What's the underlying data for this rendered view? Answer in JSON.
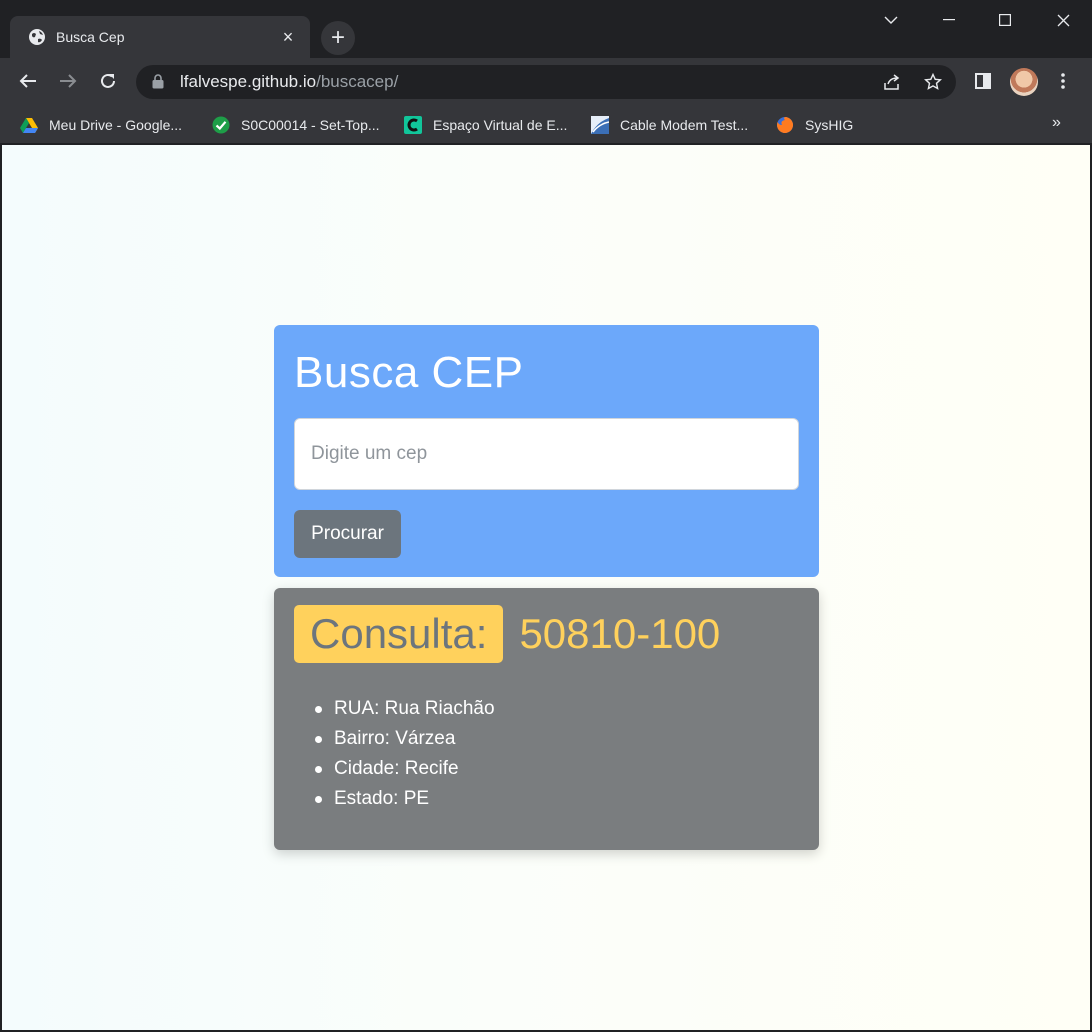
{
  "browser": {
    "tab_title": "Busca Cep",
    "tab_close": "×",
    "new_tab": "+",
    "url_domain": "lfalvespe.github.io",
    "url_path": "/buscacep/",
    "bookmarks": [
      {
        "label": "Meu Drive - Google...",
        "icon": "google-drive-icon"
      },
      {
        "label": "S0C00014 - Set-Top...",
        "icon": "check-circle-icon"
      },
      {
        "label": "Espaço Virtual de E...",
        "icon": "c-logo-icon"
      },
      {
        "label": "Cable Modem Test...",
        "icon": "cable-modem-icon"
      },
      {
        "label": "SysHIG",
        "icon": "firefox-icon"
      }
    ],
    "bookmarks_more": "»"
  },
  "search": {
    "title": "Busca CEP",
    "placeholder": "Digite um cep",
    "value": "",
    "button_label": "Procurar"
  },
  "result": {
    "badge": "Consulta:",
    "cep": "50810-100",
    "items": [
      "RUA: Rua Riachão",
      "Bairro: Várzea",
      "Cidade: Recife",
      "Estado: PE"
    ]
  },
  "colors": {
    "search_card": "#6ca8fa",
    "result_card": "#7a7d7f",
    "accent_yellow": "#ffd15c",
    "button_gray": "#6c757d",
    "chrome_dark": "#202124",
    "chrome_tab": "#35363a"
  }
}
